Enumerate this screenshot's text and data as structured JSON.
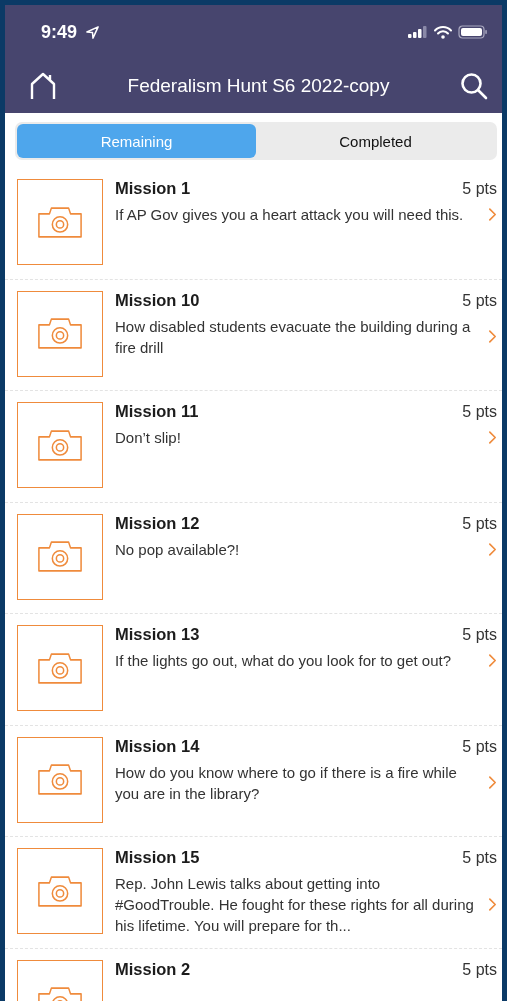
{
  "status_bar": {
    "time": "9:49"
  },
  "header": {
    "title": "Federalism Hunt S6 2022-copy"
  },
  "tabs": [
    {
      "label": "Remaining",
      "selected": true
    },
    {
      "label": "Completed",
      "selected": false
    }
  ],
  "missions": [
    {
      "title": "Mission 1",
      "points": "5 pts",
      "description": "If AP Gov gives you a heart attack you will need this."
    },
    {
      "title": "Mission 10",
      "points": "5 pts",
      "description": "How disabled students evacuate the building during a fire drill"
    },
    {
      "title": "Mission 11",
      "points": "5 pts",
      "description": "Don’t slip!"
    },
    {
      "title": "Mission 12",
      "points": "5 pts",
      "description": "No pop available?!"
    },
    {
      "title": "Mission 13",
      "points": "5 pts",
      "description": "If the lights go out, what do you look for to get out?"
    },
    {
      "title": "Mission 14",
      "points": "5 pts",
      "description": "How do you know where to go if there is a fire while you are in the library?"
    },
    {
      "title": "Mission 15",
      "points": "5 pts",
      "description": "Rep. John Lewis talks about getting into #GoodTrouble. He fought for these rights for all during his lifetime. You will prepare for th..."
    },
    {
      "title": "Mission 2",
      "points": "5 pts"
    }
  ]
}
